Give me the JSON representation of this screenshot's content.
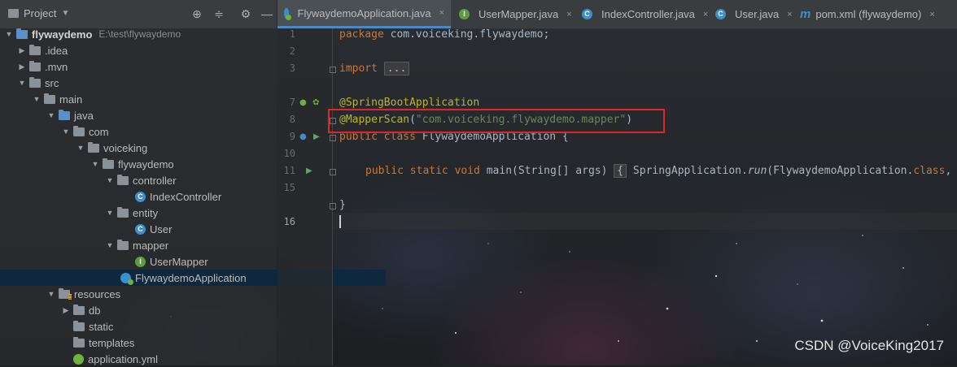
{
  "project_panel": {
    "title": "Project",
    "tree": [
      {
        "label": "flywaydemo",
        "extra": "E:\\test\\flywaydemo"
      },
      {
        "label": ".idea"
      },
      {
        "label": ".mvn"
      },
      {
        "label": "src"
      },
      {
        "label": "main"
      },
      {
        "label": "java"
      },
      {
        "label": "com"
      },
      {
        "label": "voiceking"
      },
      {
        "label": "flywaydemo"
      },
      {
        "label": "controller"
      },
      {
        "label": "IndexController"
      },
      {
        "label": "entity"
      },
      {
        "label": "User"
      },
      {
        "label": "mapper"
      },
      {
        "label": "UserMapper"
      },
      {
        "label": "FlywaydemoApplication"
      },
      {
        "label": "resources"
      },
      {
        "label": "db"
      },
      {
        "label": "static"
      },
      {
        "label": "templates"
      },
      {
        "label": "application.yml"
      }
    ]
  },
  "tabs": [
    {
      "label": "FlywaydemoApplication.java",
      "close": "×",
      "icon": "spring-class-icon"
    },
    {
      "label": "UserMapper.java",
      "close": "×",
      "icon": "interface-icon"
    },
    {
      "label": "IndexController.java",
      "close": "×",
      "icon": "class-icon"
    },
    {
      "label": "User.java",
      "close": "×",
      "icon": "class-icon"
    },
    {
      "label": "pom.xml (flywaydemo)",
      "close": "×",
      "icon": "maven-icon",
      "icon_text": "m"
    }
  ],
  "editor": {
    "line_numbers": [
      "1",
      "2",
      "3",
      "7",
      "8",
      "9",
      "10",
      "11",
      "15",
      "16"
    ],
    "code": {
      "l1_kw": "package",
      "l1_rest": " com.voiceking.flywaydemo;",
      "l3_kw": "import",
      "l3_fold": "...",
      "l7": "@SpringBootApplication",
      "l8_ann": "@MapperScan",
      "l8_open": "(",
      "l8_str": "\"com.voiceking.flywaydemo.mapper\"",
      "l8_close": ")",
      "l9_kw": "public class",
      "l9_rest": " FlywaydemoApplication {",
      "l11_kw": "public static void",
      "l11_rest1": " main(String[] args) ",
      "l11_fold": "{",
      "l11_rest2": " SpringApplication.",
      "l11_method": "run",
      "l11_rest3": "(FlywaydemoApplication.",
      "l11_kw2": "class",
      "l11_rest4": ",",
      "l15": "}"
    }
  },
  "watermark": "CSDN @VoiceKing2017",
  "colors": {
    "keyword": "#cc7832",
    "annotation": "#bbb529",
    "string": "#6a8759",
    "highlight_box": "#e0262b",
    "selection": "#0d293e"
  }
}
